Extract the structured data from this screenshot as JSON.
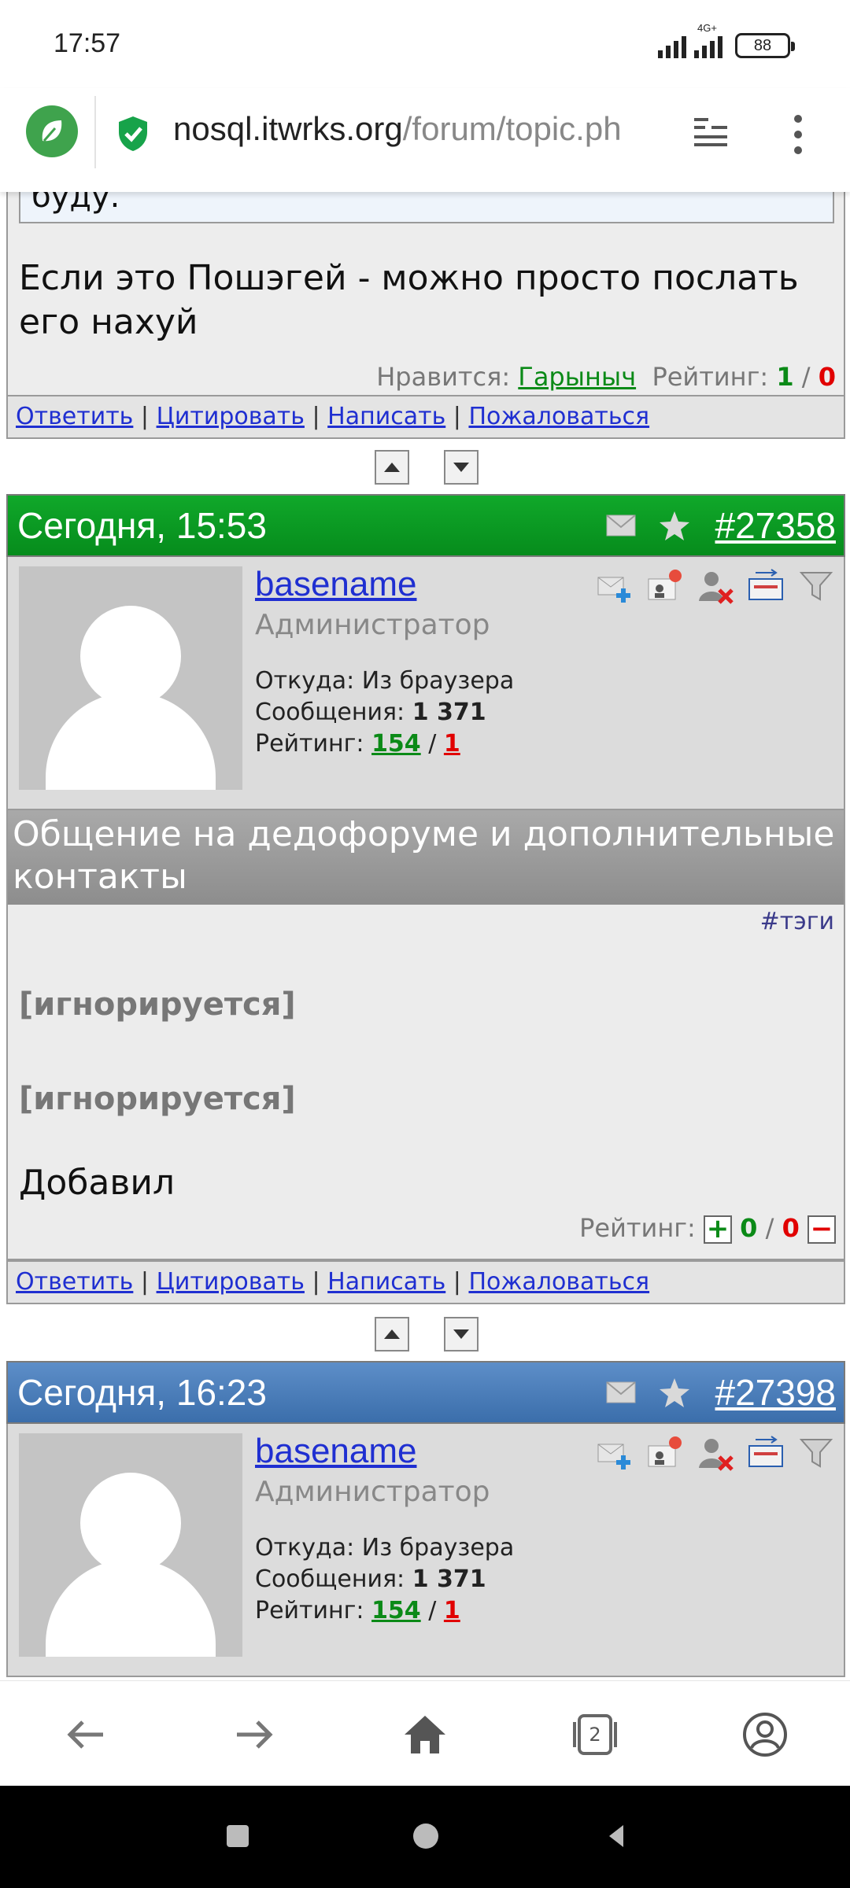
{
  "status_bar": {
    "time": "17:57",
    "network": "4G+",
    "battery": "88"
  },
  "browser": {
    "url_host": "nosql.itwrks.org",
    "url_path": "/forum/topic.ph",
    "accent": "#3fa34d",
    "tab_count": "2"
  },
  "prev_post": {
    "quote_tail": "буду.",
    "text": "Если это Пошэгей - можно просто послать его нахуй",
    "likes_label": "Нравится:",
    "liked_by": "Гарыныч",
    "rating_label": "Рейтинг:",
    "rating_plus": "1",
    "rating_sep": "/",
    "rating_minus": "0"
  },
  "actions": {
    "reply": "Ответить",
    "quote": "Цитировать",
    "write": "Написать",
    "report": "Пожаловаться",
    "sep": "|"
  },
  "posts": [
    {
      "date": "Сегодня, 15:53",
      "number": "#27358",
      "header_color": "#0a9a22",
      "author": "basename",
      "role": "Администратор",
      "from_label": "Откуда:",
      "from_value": "Из браузера",
      "messages_label": "Сообщения:",
      "messages_value": "1 371",
      "rating_label": "Рейтинг:",
      "rating_plus": "154",
      "rating_sep": "/",
      "rating_minus": "1",
      "subject": "Общение на дедофоруме и дополнительные контакты",
      "tags": "#тэги",
      "ignored_1": "[игнорируется]",
      "ignored_2": "[игнорируется]",
      "text": "Добавил",
      "post_rating_label": "Рейтинг:",
      "post_rating_plus_btn": "+",
      "post_rating_plus": "0",
      "post_rating_sep": "/",
      "post_rating_minus": "0",
      "post_rating_minus_btn": "−"
    },
    {
      "date": "Сегодня, 16:23",
      "number": "#27398",
      "header_color": "#4a7dbb",
      "author": "basename",
      "role": "Администратор",
      "from_label": "Откуда:",
      "from_value": "Из браузера",
      "messages_label": "Сообщения:",
      "messages_value": "1 371",
      "rating_label": "Рейтинг:",
      "rating_plus": "154",
      "rating_sep": "/",
      "rating_minus": "1"
    }
  ]
}
